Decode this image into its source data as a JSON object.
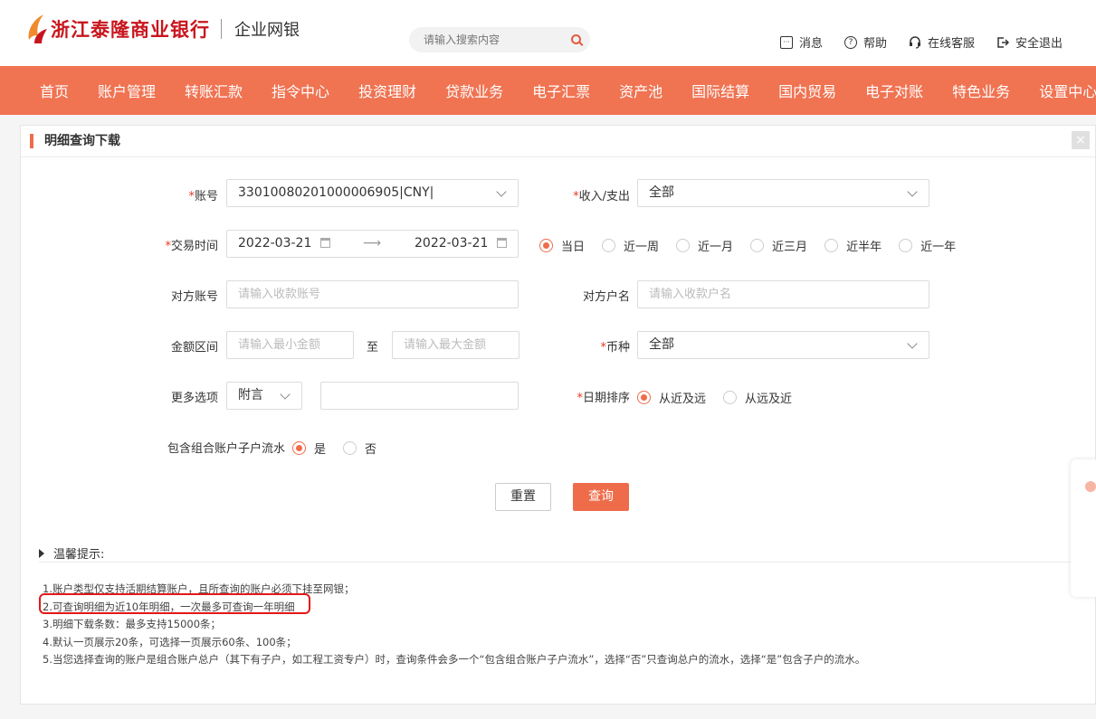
{
  "header": {
    "bank_name": "浙江泰隆商业银行",
    "portal": "企业网银",
    "search_placeholder": "请输入搜索内容",
    "actions": [
      {
        "label": "消息",
        "icon": "message-icon"
      },
      {
        "label": "帮助",
        "icon": "help-icon"
      },
      {
        "label": "在线客服",
        "icon": "headset-icon"
      },
      {
        "label": "安全退出",
        "icon": "logout-icon"
      }
    ]
  },
  "nav": [
    "首页",
    "账户管理",
    "转账汇款",
    "指令中心",
    "投资理财",
    "贷款业务",
    "电子汇票",
    "资产池",
    "国际结算",
    "国内贸易",
    "电子对账",
    "特色业务",
    "设置中心"
  ],
  "panel": {
    "title": "明细查询下载",
    "close": "×"
  },
  "form": {
    "account_label": "账号",
    "account_value": "33010080201000006905|CNY|",
    "inout_label": "收入/支出",
    "inout_value": "全部",
    "time_label": "交易时间",
    "date_from": "2022-03-21",
    "date_to": "2022-03-21",
    "date_arrow": "⟶",
    "periods": [
      "当日",
      "近一周",
      "近一月",
      "近三月",
      "近半年",
      "近一年"
    ],
    "counter_account_label": "对方账号",
    "counter_account_placeholder": "请输入收款账号",
    "counter_name_label": "对方户名",
    "counter_name_placeholder": "请输入收款户名",
    "amount_label": "金额区间",
    "amount_min_placeholder": "请输入最小金额",
    "amount_to": "至",
    "amount_max_placeholder": "请输入最大金额",
    "currency_label": "币种",
    "currency_value": "全部",
    "more_label": "更多选项",
    "more_value": "附言",
    "sort_label": "日期排序",
    "sort_options": [
      "从近及远",
      "从远及近"
    ],
    "sub_label": "包含组合账户子户流水",
    "sub_options": [
      "是",
      "否"
    ],
    "required_mark": "*"
  },
  "buttons": {
    "reset": "重置",
    "query": "查询"
  },
  "tips": {
    "title": "温馨提示:",
    "lines": [
      "1.账户类型仅支持活期结算账户，且所查询的账户必须下挂至网银；",
      "2.可查询明细为近10年明细，一次最多可查询一年明细",
      "3.明细下载条数：最多支持15000条；",
      "4.默认一页展示20条，可选择一页展示60条、100条；",
      "5.当您选择查询的账户是组合账户总户（其下有子户，如工程工资专户）时，查询条件会多一个“包含组合账户子户流水”，选择“否”只查询总户的流水，选择“是”包含子户的流水。"
    ]
  },
  "colors": {
    "nav_bg": "#f07352",
    "accent": "#ef6c4b",
    "brand_red": "#c8161d",
    "highlight": "#e41818"
  }
}
